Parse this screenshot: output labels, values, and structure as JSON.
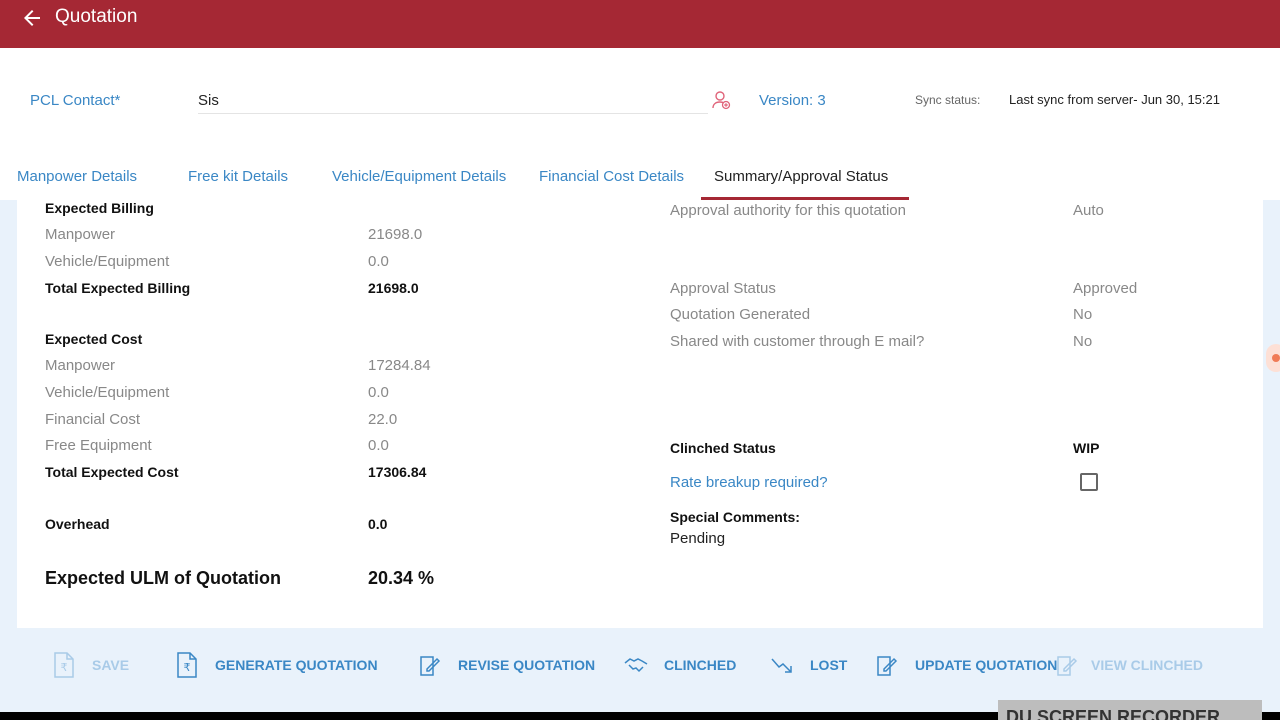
{
  "app": {
    "title": "Quotation"
  },
  "contact": {
    "pcl_label": "PCL Contact*",
    "pcl_value": "Sis",
    "version": "Version: 3",
    "sync_label": "Sync status:",
    "sync_value": "Last sync from server-  Jun 30, 15:21"
  },
  "tabs": [
    {
      "label": "Manpower Details"
    },
    {
      "label": "Free kit Details"
    },
    {
      "label": "Vehicle/Equipment Details"
    },
    {
      "label": "Financial Cost Details"
    },
    {
      "label": "Summary/Approval Status",
      "active": true
    }
  ],
  "billing": {
    "heading": "Expected Billing",
    "rows": [
      {
        "label": "Manpower",
        "value": "21698.0"
      },
      {
        "label": "Vehicle/Equipment",
        "value": "0.0"
      }
    ],
    "total_label": "Total Expected Billing",
    "total_value": "21698.0"
  },
  "cost": {
    "heading": "Expected Cost",
    "rows": [
      {
        "label": "Manpower",
        "value": "17284.84"
      },
      {
        "label": "Vehicle/Equipment",
        "value": "0.0"
      },
      {
        "label": "Financial Cost",
        "value": "22.0"
      },
      {
        "label": "Free Equipment",
        "value": "0.0"
      }
    ],
    "total_label": "Total Expected Cost",
    "total_value": "17306.84"
  },
  "overhead": {
    "label": "Overhead",
    "value": "0.0"
  },
  "ulm": {
    "label": "Expected ULM of Quotation",
    "value": "20.34 %"
  },
  "approval": {
    "authority_label": "Approval authority for this quotation",
    "authority_value": "Auto",
    "status_label": "Approval Status",
    "status_value": "Approved",
    "generated_label": "Quotation Generated",
    "generated_value": "No",
    "shared_label": "Shared with customer through E mail?",
    "shared_value": "No",
    "clinched_label": "Clinched Status",
    "clinched_value": "WIP",
    "rate_breakup_label": "Rate breakup required?",
    "comments_label": "Special Comments:",
    "comments_value": "Pending"
  },
  "actions": {
    "save": "SAVE",
    "generate": "GENERATE QUOTATION",
    "revise": "REVISE QUOTATION",
    "clinched": "CLINCHED",
    "lost": "LOST",
    "update": "UPDATE QUOTATION",
    "view_clinched": "VIEW CLINCHED"
  },
  "overlay": {
    "recorder": "DU SCREEN RECORDER"
  },
  "colors": {
    "brand": "#a52834",
    "link": "#3a87c5",
    "background": "#e9f2fb"
  }
}
